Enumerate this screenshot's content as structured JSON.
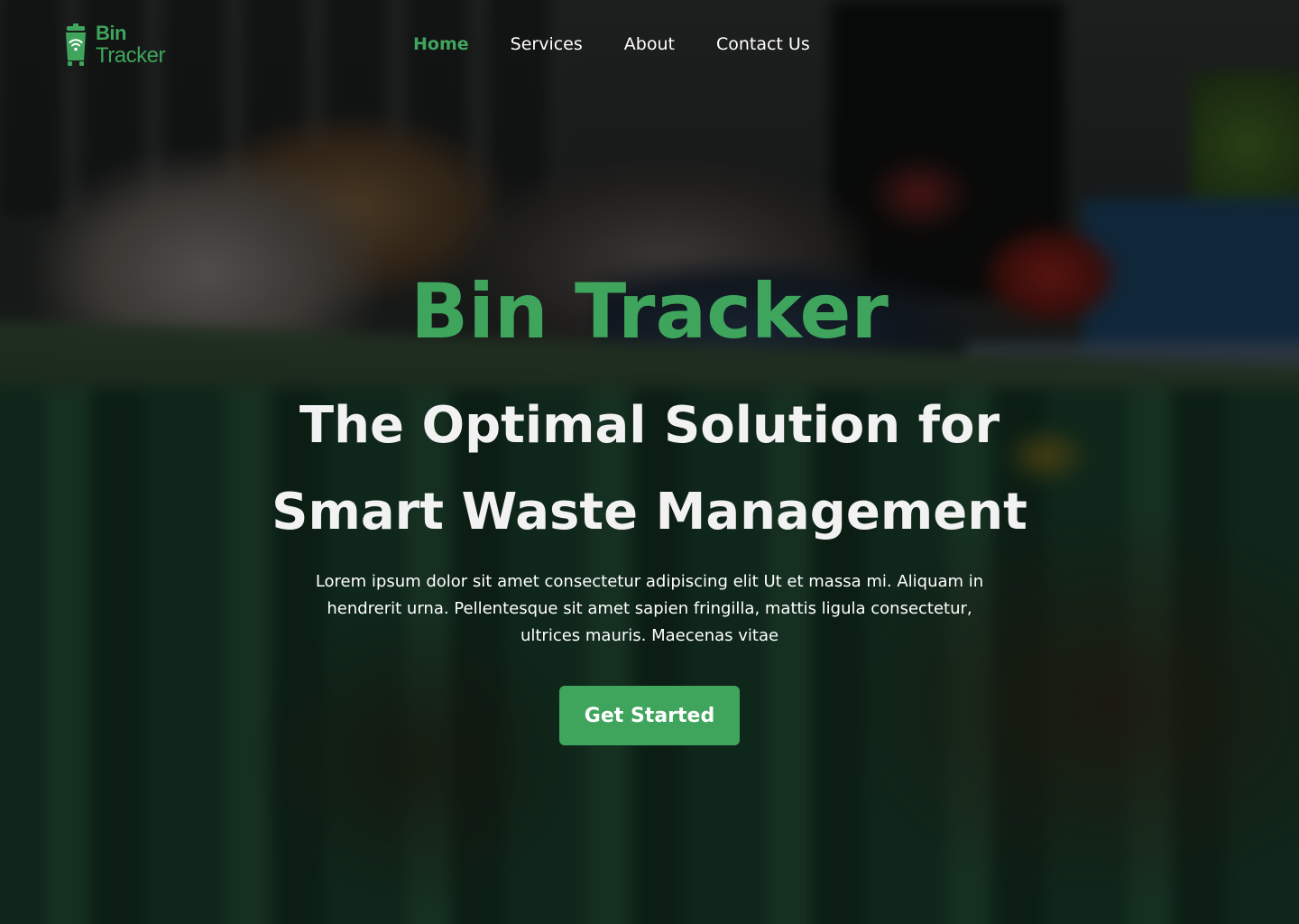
{
  "brand": {
    "name_line1": "Bin",
    "name_line2": "Tracker",
    "accent_color": "#3fa55d"
  },
  "nav": {
    "items": [
      {
        "label": "Home",
        "active": true
      },
      {
        "label": "Services",
        "active": false
      },
      {
        "label": "About",
        "active": false
      },
      {
        "label": "Contact Us",
        "active": false
      }
    ]
  },
  "hero": {
    "title": "Bin Tracker",
    "subtitle_line1": "The Optimal Solution for",
    "subtitle_line2": "Smart Waste Management",
    "description": "Lorem ipsum dolor sit amet consectetur adipiscing elit Ut et massa mi. Aliquam in hendrerit urna. Pellentesque sit amet sapien fringilla, mattis ligula consectetur, ultrices mauris. Maecenas vitae",
    "cta_label": "Get Started",
    "background": "blurred photo of overflowing green dumpster"
  },
  "icons": {
    "logo": "trash-bin-wifi-icon"
  }
}
